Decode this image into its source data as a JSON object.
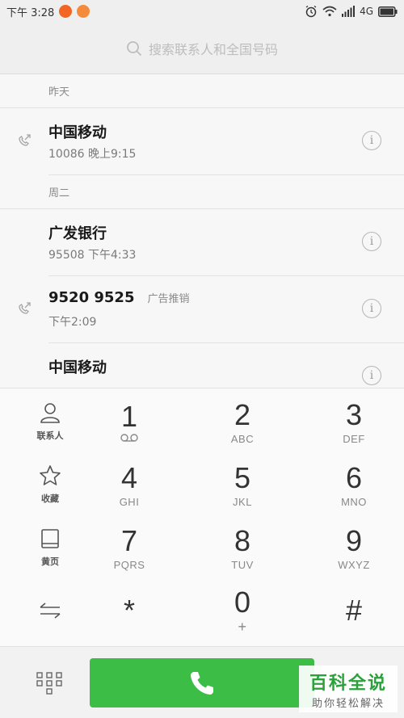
{
  "status_bar": {
    "time": "下午 3:28",
    "network": "4G"
  },
  "search": {
    "placeholder": "搜索联系人和全国号码"
  },
  "call_log": {
    "sections": [
      {
        "header": "昨天",
        "calls": [
          {
            "name": "中国移动",
            "tag": "",
            "detail": "10086 晚上9:15",
            "direction": "outgoing"
          }
        ]
      },
      {
        "header": "周二",
        "calls": [
          {
            "name": "广发银行",
            "tag": "",
            "detail": "95508 下午4:33",
            "direction": ""
          },
          {
            "name": "9520 9525",
            "tag": "广告推销",
            "detail": "下午2:09",
            "direction": "outgoing"
          },
          {
            "name": "中国移动",
            "tag": "",
            "detail": "",
            "direction": ""
          }
        ]
      }
    ]
  },
  "dialpad": {
    "side": [
      "联系人",
      "收藏",
      "黄页"
    ],
    "keys": [
      {
        "digit": "1",
        "letters": ""
      },
      {
        "digit": "2",
        "letters": "ABC"
      },
      {
        "digit": "3",
        "letters": "DEF"
      },
      {
        "digit": "4",
        "letters": "GHI"
      },
      {
        "digit": "5",
        "letters": "JKL"
      },
      {
        "digit": "6",
        "letters": "MNO"
      },
      {
        "digit": "7",
        "letters": "PQRS"
      },
      {
        "digit": "8",
        "letters": "TUV"
      },
      {
        "digit": "9",
        "letters": "WXYZ"
      },
      {
        "digit": "*",
        "letters": ""
      },
      {
        "digit": "0",
        "letters": "+"
      },
      {
        "digit": "#",
        "letters": ""
      }
    ]
  },
  "watermark": {
    "title": "百科全说",
    "subtitle": "助你轻松解决"
  },
  "colors": {
    "call_button": "#3cbd46",
    "watermark_green": "#2aa13a"
  }
}
